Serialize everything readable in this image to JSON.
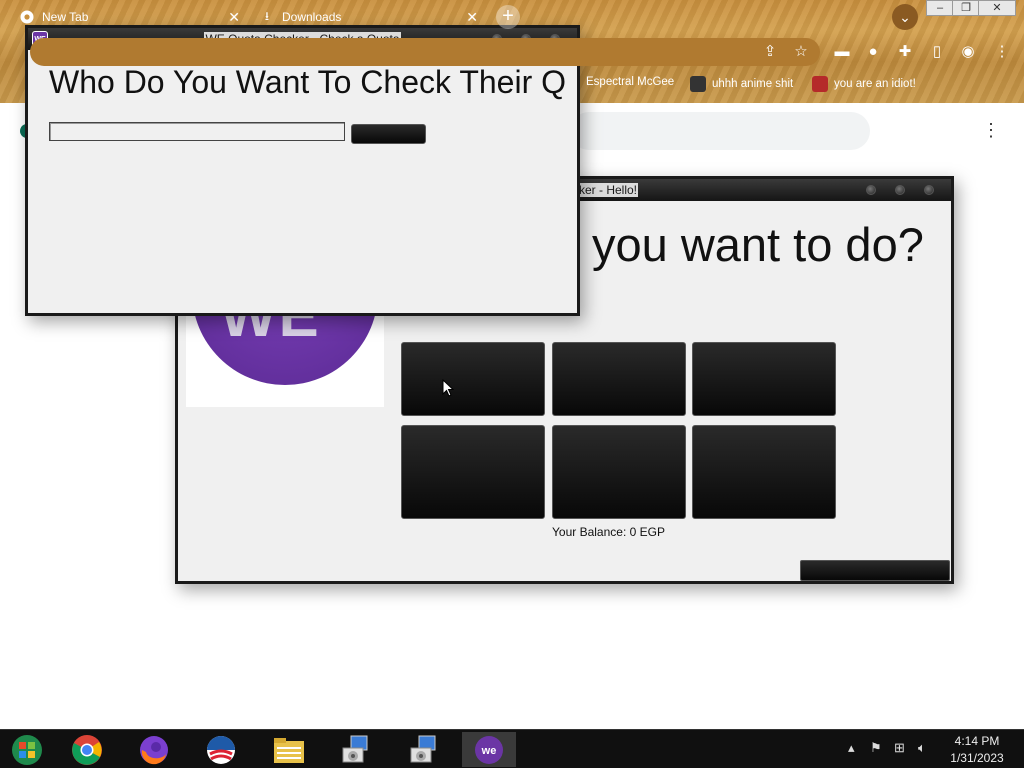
{
  "browser": {
    "tabs": [
      {
        "label": "New Tab",
        "icon": "chrome-icon"
      },
      {
        "label": "Downloads",
        "icon": "download-icon"
      }
    ],
    "bookmarks": [
      {
        "label": "Espectral McGee"
      },
      {
        "label": "uhhh anime shit"
      },
      {
        "label": "you are an idiot!"
      }
    ]
  },
  "hello_window": {
    "title_visible": "ker - Hello!",
    "question_visible": "you want to do?",
    "balance_text": "Your Balance: 0 EGP",
    "logo_text": "WE"
  },
  "quota_window": {
    "title": "WE Quota Checker - Check a Quota",
    "heading_visible": "Who Do You Want To Check Their Q",
    "input_value": "",
    "app_icon_text": "WE"
  },
  "taskbar": {
    "time": "4:14 PM",
    "date": "1/31/2023",
    "apps": [
      "start-button",
      "chrome-icon",
      "firefox-icon",
      "obama-icon",
      "file-explorer-icon",
      "installer-icon",
      "installer-icon",
      "we-app-icon"
    ]
  },
  "colors": {
    "we_purple": "#6b35a5",
    "window_bg": "#f0f0f0",
    "chrome_theme": "#c9903e"
  }
}
